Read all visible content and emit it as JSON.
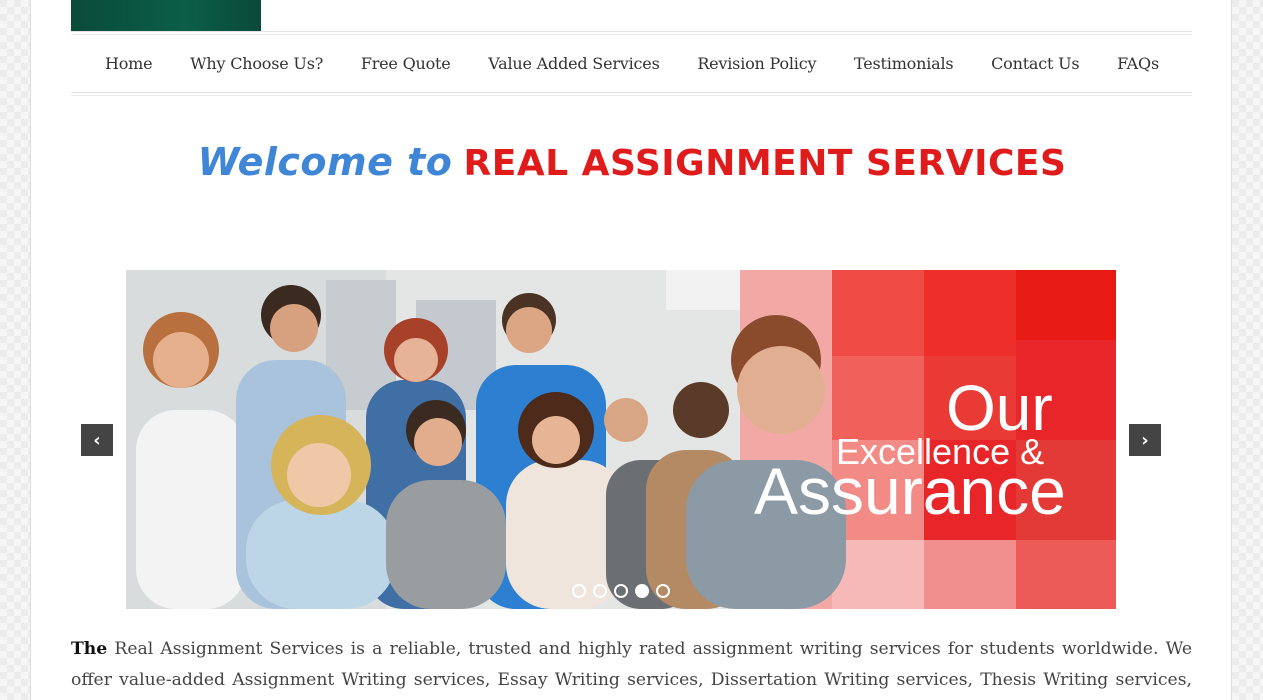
{
  "nav": {
    "items": [
      {
        "label": "Home"
      },
      {
        "label": "Why Choose Us?"
      },
      {
        "label": "Free Quote"
      },
      {
        "label": "Value Added Services"
      },
      {
        "label": "Revision Policy"
      },
      {
        "label": "Testimonials"
      },
      {
        "label": "Contact Us"
      },
      {
        "label": "FAQs"
      }
    ]
  },
  "welcome": {
    "prefix": "Welcome to",
    "brand": "REAL ASSIGNMENT SERVICES"
  },
  "slider": {
    "banner_line1": "Our",
    "banner_line2": "Excellence &",
    "banner_line3": "Assurance",
    "prev_icon": "chevron-left-icon",
    "next_icon": "chevron-right-icon",
    "prev_glyph": "‹",
    "next_glyph": "›",
    "active_dot_index": 3,
    "dot_count": 5
  },
  "intro": {
    "lead": "The",
    "text": "Real Assignment Services is a reliable, trusted and highly rated assignment writing services for students worldwide. We offer value-added Assignment Writing services, Essay Writing services, Dissertation Writing services, Thesis Writing services, Term"
  },
  "colors": {
    "welcome_blue": "#3f86d6",
    "brand_red": "#e01b1b",
    "logo_green": "#0b5e48",
    "banner_red": "#e8262a"
  }
}
